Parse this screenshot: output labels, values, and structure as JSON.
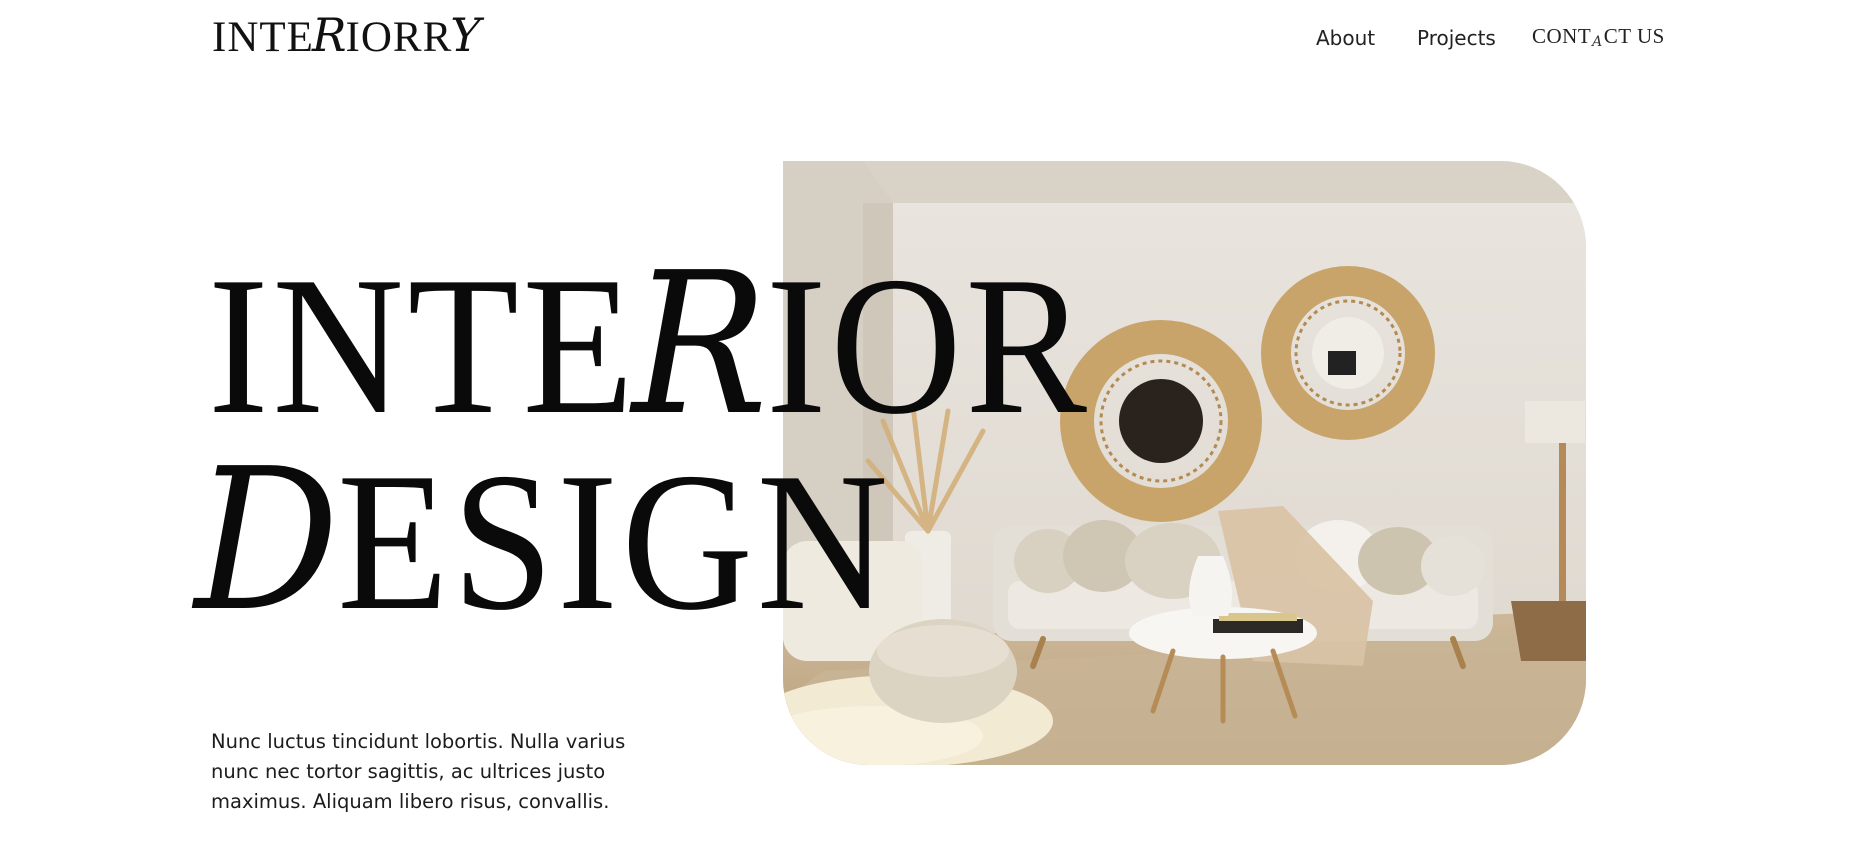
{
  "header": {
    "logo": {
      "part1": "INTE",
      "script": "R",
      "part2": "IORR",
      "script2": "Y"
    },
    "nav": {
      "about": "About",
      "projects": "Projects",
      "contact": {
        "part1": "CONT",
        "script": "A",
        "part2": "CT US"
      }
    }
  },
  "hero": {
    "line1": {
      "part1": "INTE",
      "script": "R",
      "part2": "IOR"
    },
    "line2": {
      "script": "D",
      "part2": "ESIGN"
    },
    "description": "Nunc luctus tincidunt lobortis. Nulla varius nunc nec tortor sagittis, ac ultrices justo maximus. Aliquam libero risus, convallis."
  },
  "colors": {
    "background": "#ffffff",
    "text": "#0a0a0a",
    "wall": "#e3ddd4",
    "rattan": "#c9a46a"
  }
}
